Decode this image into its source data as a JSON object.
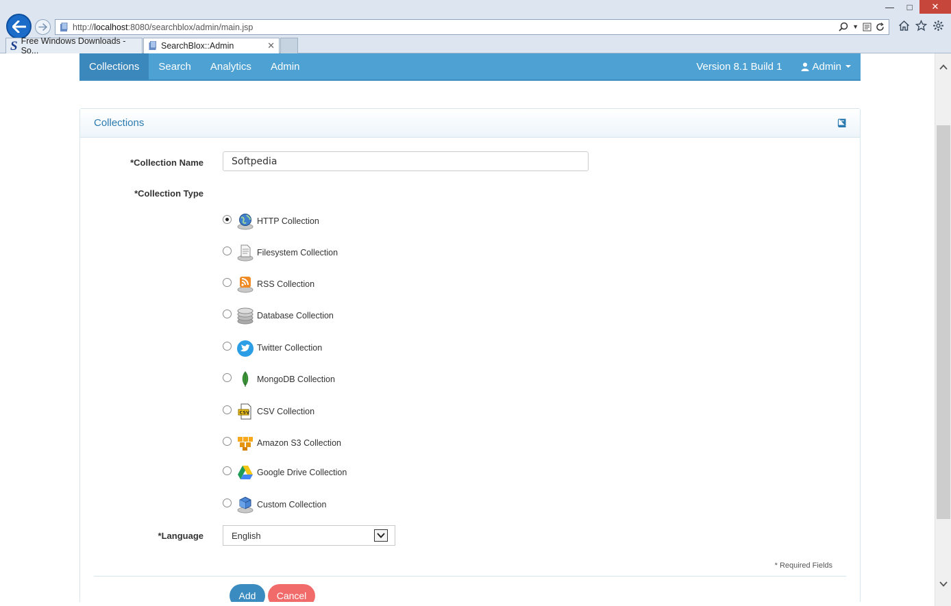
{
  "browser": {
    "url_prefix": "http://",
    "url_host": "localhost",
    "url_rest": ":8080/searchblox/admin/main.jsp",
    "tabs": [
      {
        "title": "Free Windows Downloads - So..."
      },
      {
        "title": "SearchBlox::Admin"
      }
    ]
  },
  "navbar": {
    "items": [
      {
        "label": "Collections"
      },
      {
        "label": "Search"
      },
      {
        "label": "Analytics"
      },
      {
        "label": "Admin"
      }
    ],
    "version": "Version 8.1 Build 1",
    "user": "Admin"
  },
  "panel": {
    "title": "Collections"
  },
  "form": {
    "name_label": "*Collection Name",
    "name_value": "Softpedia",
    "type_label": "*Collection Type",
    "types": [
      {
        "label": "HTTP Collection",
        "icon": "globe-icon",
        "checked": true
      },
      {
        "label": "Filesystem Collection",
        "icon": "document-icon",
        "checked": false
      },
      {
        "label": "RSS Collection",
        "icon": "rss-icon",
        "checked": false
      },
      {
        "label": "Database Collection",
        "icon": "database-icon",
        "checked": false
      },
      {
        "label": "Twitter Collection",
        "icon": "twitter-icon",
        "checked": false
      },
      {
        "label": "MongoDB Collection",
        "icon": "mongodb-leaf-icon",
        "checked": false
      },
      {
        "label": "CSV Collection",
        "icon": "csv-file-icon",
        "checked": false
      },
      {
        "label": "Amazon S3 Collection",
        "icon": "amazon-s3-icon",
        "checked": false
      },
      {
        "label": "Google Drive Collection",
        "icon": "google-drive-icon",
        "checked": false
      },
      {
        "label": "Custom Collection",
        "icon": "cube-icon",
        "checked": false
      }
    ],
    "language_label": "*Language",
    "language_value": "English",
    "required_note": "* Required Fields",
    "add_label": "Add",
    "cancel_label": "Cancel"
  },
  "colors": {
    "navbar": "#4ea1d3",
    "navbar_active": "#3b88bd",
    "panel_title": "#2a7ab0",
    "add_button": "#3a8cc0",
    "cancel_button": "#f26b6b"
  }
}
